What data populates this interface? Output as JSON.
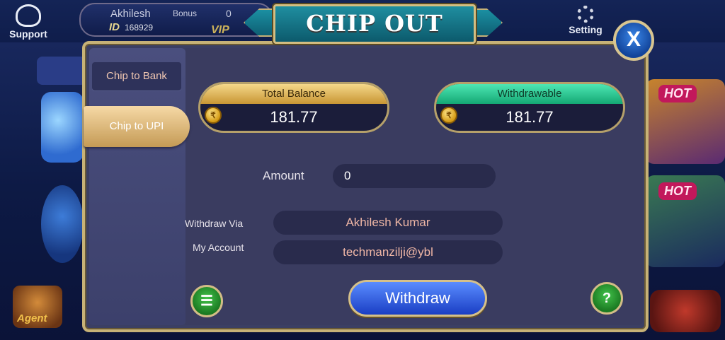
{
  "background": {
    "support_label": "Support",
    "setting_label": "Setting",
    "profile": {
      "name": "Akhilesh",
      "bonus_label": "Bonus",
      "bonus_value": "0",
      "id_label": "ID",
      "id_value": "168929"
    },
    "vip_label": "VIP",
    "agent_label": "Agent",
    "hot_badge": "HOT"
  },
  "dialog": {
    "title": "CHIP OUT",
    "close_label": "X",
    "tabs": [
      {
        "label": "Chip to Bank",
        "active": false
      },
      {
        "label": "Chip to UPI",
        "active": true
      }
    ],
    "total_balance": {
      "label": "Total Balance",
      "value": "181.77"
    },
    "withdrawable": {
      "label": "Withdrawable",
      "value": "181.77"
    },
    "amount": {
      "label": "Amount",
      "value": "0"
    },
    "withdraw_via": {
      "label": "Withdraw Via",
      "value": "Akhilesh Kumar"
    },
    "my_account": {
      "label": "My Account",
      "value": "techmanzilji@ybl"
    },
    "withdraw_button": "Withdraw",
    "help_label": "?"
  },
  "colors": {
    "accent_gold": "#c7b277",
    "dialog_bg": "#3a3c60",
    "withdraw_blue": "#2a52d8",
    "green_button": "#2aa033"
  }
}
